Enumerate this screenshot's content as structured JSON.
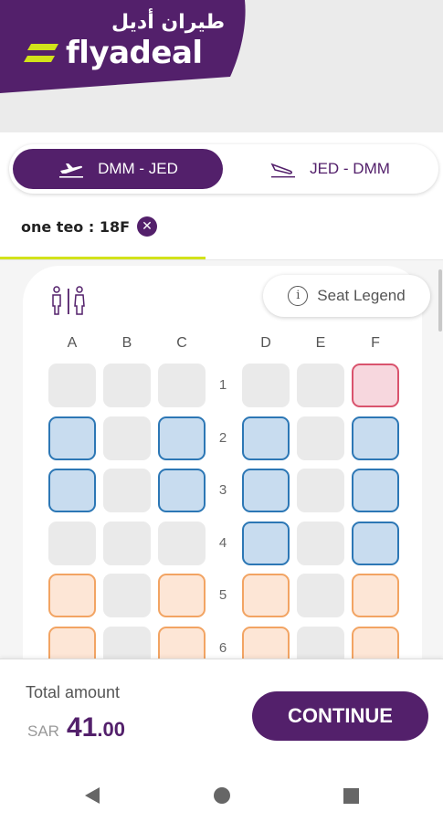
{
  "brand": {
    "name_ar": "طيران أديل",
    "name_en": "flyadeal",
    "primary": "#53206b",
    "accent": "#d2e21a"
  },
  "routes": [
    {
      "label": "DMM - JED",
      "active": true,
      "icon": "departure-plane-icon"
    },
    {
      "label": "JED - DMM",
      "active": false,
      "icon": "arrival-plane-icon"
    }
  ],
  "passenger": {
    "label": "one teo :  18F",
    "close_icon": "close-icon"
  },
  "lavatory_icon": "lavatory-icon",
  "legend": {
    "label": "Seat Legend",
    "icon": "info-icon",
    "icon_glyph": "i"
  },
  "columns": [
    "A",
    "B",
    "C",
    "D",
    "E",
    "F"
  ],
  "rows": [
    {
      "number": "1",
      "seats": [
        "unavail",
        "unavail",
        "unavail",
        "unavail",
        "unavail",
        "selected"
      ]
    },
    {
      "number": "2",
      "seats": [
        "standard",
        "unavail",
        "standard",
        "standard",
        "unavail",
        "standard"
      ]
    },
    {
      "number": "3",
      "seats": [
        "standard",
        "unavail",
        "standard",
        "standard",
        "unavail",
        "standard"
      ]
    },
    {
      "number": "4",
      "seats": [
        "unavail",
        "unavail",
        "unavail",
        "standard",
        "unavail",
        "standard"
      ]
    },
    {
      "number": "5",
      "seats": [
        "extra",
        "unavail",
        "extra",
        "extra",
        "unavail",
        "extra"
      ]
    },
    {
      "number": "6",
      "seats": [
        "extra",
        "unavail",
        "extra",
        "extra",
        "unavail",
        "extra"
      ]
    }
  ],
  "footer": {
    "total_label": "Total amount",
    "currency": "SAR",
    "amount_int": "41",
    "amount_dec": ".00",
    "continue_label": "CONTINUE"
  },
  "navbar": {
    "back": "back-icon",
    "home": "home-icon",
    "recent": "recent-apps-icon"
  }
}
